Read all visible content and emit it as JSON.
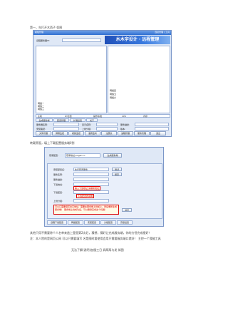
{
  "captions": {
    "c1": "第一，先打开木西子 如图",
    "c2": "转载界面，填上下载配置服务端0到",
    "c3": "其他只用不需要除个人名单来逃上登是第2次后，猜想，猜好让完成服务端，你的方恒完成接好！",
    "c4": "注：本人院的是网页公网  可以只需要填写  名是随时要使用会用只需要服务端口就好！ 主控一个我能工具",
    "c5": "无法了解(说明)加服工日    具两两与发 如图"
  },
  "screen1": {
    "title": "模板管理",
    "title_right": "连接管理 | 工具",
    "banner": "水木宇设计 · 远程管理",
    "left_label": "远程服务器IP:",
    "tree_items": [
      "网络一",
      "网络二",
      "网络三",
      "网络四",
      "网络五",
      "网络六"
    ],
    "status": [
      "主机",
      "IP/位置",
      "操作系统",
      "CPU",
      "内存"
    ],
    "tabs": [
      "生成服务端",
      "配置管理",
      "扩展设置",
      "关于"
    ],
    "labels": [
      "服务器名称:",
      "显示名称:",
      "服务描述:",
      "安装路径:",
      "上线分组:",
      "版本:"
    ],
    "buttons": [
      "文件管理",
      "屏幕监控",
      "视频监控",
      "语音监听",
      "注册表",
      "进程管理",
      "服务管理",
      "退出"
    ]
  },
  "screen2": {
    "top_label": "登录配置:",
    "top_value": "登录地址:pogan.cc",
    "top_button": "生成服务端",
    "form_labels": [
      "安装配置名:",
      "服务名称:",
      "服务描述:",
      "下载地址:",
      "下载配置:",
      "上线分组:"
    ],
    "form_values": [
      "执行配置服务",
      "",
      "",
      "",
      "",
      ""
    ],
    "form_button": "测试",
    "form_button2": "保存",
    "callout1": "输入下载地址 请填写地址",
    "callout2": "下载配置的说明",
    "callout3": "可以只需要填写出口地址，需要在服务端上线加上，然后重新生成服务端！",
    "callout3b": "服务端上线成功后，可以删除完成这个机器！",
    "side_button": "浏览",
    "tabs": [
      "远程下载配置",
      "网络配置",
      "安装配置",
      "分组配置",
      "高级设置"
    ]
  }
}
